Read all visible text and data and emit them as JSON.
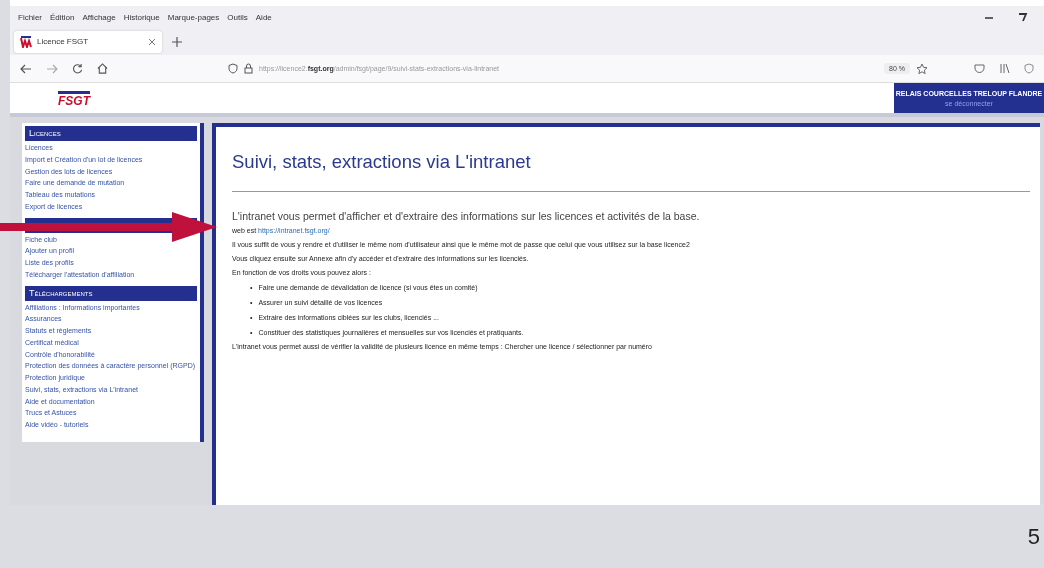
{
  "browser": {
    "menu": [
      "Fichier",
      "Édition",
      "Affichage",
      "Historique",
      "Marque-pages",
      "Outils",
      "Aide"
    ],
    "tab": {
      "title": "Licence FSGT"
    },
    "url": {
      "prefix": "https://licence2.",
      "domain": "fsgt.org",
      "path": "/admin/fsgt/page/9/suivi-stats-extractions-via-lintranet"
    },
    "zoom": "80 %"
  },
  "header": {
    "logo": "FSGT",
    "club": "RELAIS COURCELLES TRELOUP FLANDRE",
    "logout": "se déconnecter"
  },
  "sidebar": [
    {
      "heading": "Licences",
      "items": [
        "Licences",
        "Import et Création d'un lot de licences",
        "Gestion des lots de licences",
        "Faire une demande de mutation",
        "Tableau des mutations",
        "Export de licences"
      ]
    },
    {
      "items": [
        "Fiche club",
        "Ajouter un profil",
        "Liste des profils",
        "Télécharger l'attestation d'affiliation"
      ]
    },
    {
      "heading": "Téléchargements",
      "items": [
        "Affiliations : Informations importantes",
        "Assurances",
        "Statuts et règlements",
        "Certificat médical",
        "Contrôle d'honorabilité",
        "Protection des données à caractère personnel (RGPD)",
        "Protection juridique",
        "Suivi, stats, extractions via L'intranet",
        "Aide et documentation",
        "Trucs et Astuces",
        "Aide vidéo - tutoriels"
      ]
    }
  ],
  "main": {
    "title": "Suivi, stats, extractions via L'intranet",
    "intro": "L'intranet vous permet d'afficher et d'extraire des informations sur les licences et activités de la base.",
    "site_prefix": "web est",
    "site_link": "https://intranet.fsgt.org/",
    "paragraphs": [
      "Il vous suffit de vous y rendre et d'utiliser le même nom d'utilisateur ainsi que le même mot de passe que celui que vous utilisez sur la base licence2",
      "Vous cliquez ensuite sur Annexe afin d'y accéder et d'extraire des informations sur les licenciés.",
      "En fonction de vos droits vous pouvez alors :"
    ],
    "bullet": "•",
    "list": [
      "Faire une demande de dévalidation de licence (si vous êtes un comité)",
      "Assurer un suivi détaillé de vos licences",
      "Extraire des informations ciblées sur les clubs, licenciés ...",
      "Constituer des statistiques journalières et mensuelles sur vos licenciés et pratiquants."
    ],
    "footer": "L'intranet vous permet aussi de vérifier la validité de plusieurs licence en même temps  : Chercher une licence / sélectionner par numéro"
  },
  "slide": {
    "page_number": "5"
  }
}
